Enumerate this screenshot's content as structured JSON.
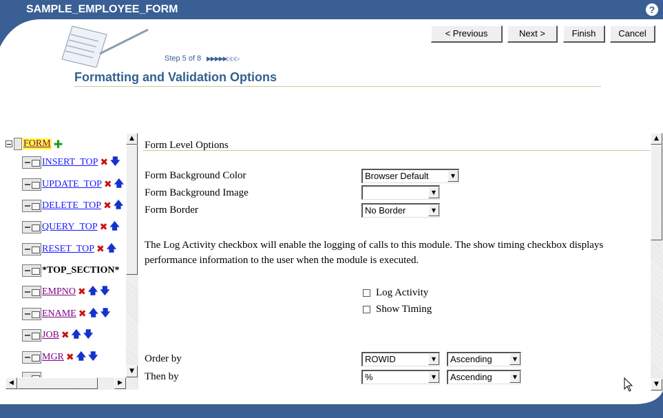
{
  "window": {
    "title": "SAMPLE_EMPLOYEE_FORM",
    "help_icon": "?"
  },
  "wizard": {
    "step_text": "Step 5 of 8",
    "step_indicator": "▶▶▶▶▶▷▷▷",
    "page_title": "Formatting and Validation Options"
  },
  "buttons": {
    "previous": "< Previous",
    "next": "Next >",
    "finish": "Finish",
    "cancel": "Cancel"
  },
  "tree": {
    "root": {
      "label": "FORM"
    },
    "items": [
      {
        "label": "INSERT_TOP",
        "link": true
      },
      {
        "label": "UPDATE_TOP",
        "link": true
      },
      {
        "label": "DELETE_TOP",
        "link": true
      },
      {
        "label": "QUERY_TOP",
        "link": true
      },
      {
        "label": "RESET_TOP",
        "link": true
      },
      {
        "label": "*TOP_SECTION*",
        "link": false
      },
      {
        "label": "EMPNO",
        "link": true
      },
      {
        "label": "ENAME",
        "link": true
      },
      {
        "label": "JOB",
        "link": true
      },
      {
        "label": "MGR",
        "link": true
      }
    ]
  },
  "form_options": {
    "heading": "Form Level Options",
    "background_color": {
      "label": "Form Background Color",
      "value": "Browser Default"
    },
    "background_image": {
      "label": "Form Background Image",
      "value": ""
    },
    "border": {
      "label": "Form Border",
      "value": "No Border"
    },
    "description": "The Log Activity checkbox will enable the logging of calls to this module. The show timing checkbox displays performance information to the user when the module is executed.",
    "log_activity": {
      "label": "Log Activity",
      "checked": false
    },
    "show_timing": {
      "label": "Show Timing",
      "checked": false
    },
    "order_by": {
      "label": "Order by",
      "column": "ROWID",
      "direction": "Ascending"
    },
    "then_by": {
      "label": "Then by",
      "column": "%",
      "direction": "Ascending"
    }
  },
  "colors": {
    "title_bar": "#3a5f94",
    "title_text": "#33618f",
    "link": "#1a1aff",
    "visited_link": "#800080",
    "highlight": "#ffff33"
  }
}
